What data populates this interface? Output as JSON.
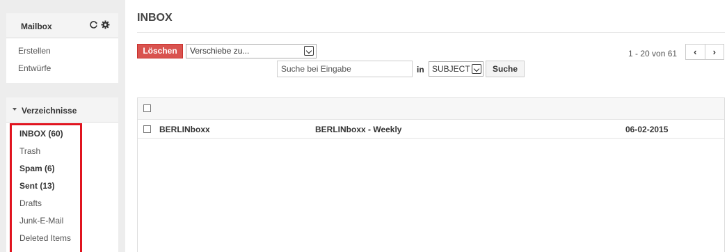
{
  "sidebar": {
    "mailbox": {
      "title": "Mailbox",
      "icons": [
        "refresh-icon",
        "gear-icon"
      ],
      "links": [
        "Erstellen",
        "Entwürfe"
      ]
    },
    "folders": {
      "title": "Verzeichnisse",
      "items": [
        {
          "label": "INBOX (60)",
          "bold": true
        },
        {
          "label": "Trash",
          "bold": false
        },
        {
          "label": "Spam (6)",
          "bold": true
        },
        {
          "label": "Sent (13)",
          "bold": true
        },
        {
          "label": "Drafts",
          "bold": false
        },
        {
          "label": "Junk-E-Mail",
          "bold": false
        },
        {
          "label": "Deleted Items",
          "bold": false
        }
      ],
      "highlight_color": "#e0141f"
    }
  },
  "main": {
    "title": "INBOX",
    "toolbar": {
      "delete_label": "Löschen",
      "delete_color": "#d9534f",
      "move_select_value": "Verschiebe zu...",
      "search_placeholder": "Suche bei Eingabe",
      "in_label": "in",
      "field_select_value": "SUBJECT",
      "search_button": "Suche"
    },
    "pagination": {
      "text": "1 - 20 von 61",
      "prev": "‹",
      "next": "›"
    },
    "messages": [
      {
        "from": "BERLINboxx",
        "subject": "BERLINboxx - Weekly",
        "date": "06-02-2015"
      }
    ]
  }
}
